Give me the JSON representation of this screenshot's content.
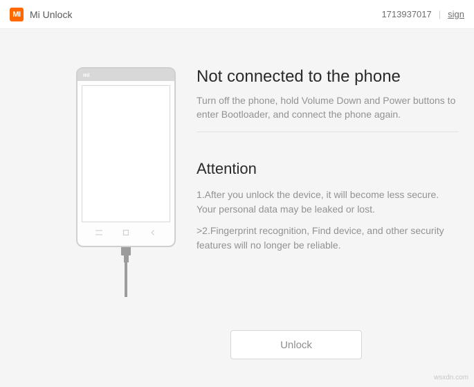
{
  "header": {
    "logo_text": "MI",
    "app_title": "Mi Unlock",
    "user_id": "1713937017",
    "sign_link": "sign"
  },
  "phone": {
    "brand": "mi"
  },
  "status": {
    "title": "Not connected to the phone",
    "description": "Turn off the phone, hold Volume Down and Power buttons to enter Bootloader, and connect the phone again."
  },
  "attention": {
    "title": "Attention",
    "item1": "1.After you unlock the device, it will become less secure. Your personal data may be leaked or lost.",
    "item2": ">2.Fingerprint recognition, Find device, and other security features will no longer be reliable."
  },
  "actions": {
    "unlock_label": "Unlock"
  },
  "watermark": "wsxdn.com"
}
